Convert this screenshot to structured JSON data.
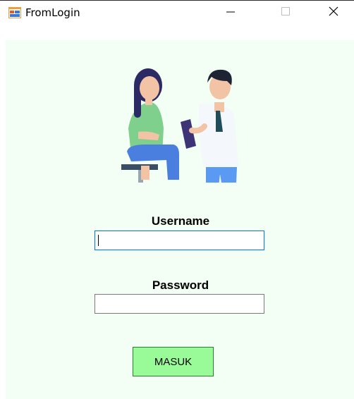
{
  "window": {
    "title": "FromLogin",
    "icons": [
      "app-form-icon",
      "minimize-icon",
      "maximize-icon",
      "close-icon"
    ]
  },
  "form": {
    "illustration": "patient-and-doctor-illustration",
    "username_label": "Username",
    "username_value": "",
    "password_label": "Password",
    "password_value": "",
    "submit_label": "MASUK"
  },
  "colors": {
    "client_background": "#f3fff4",
    "button_background": "#98fb98",
    "focus_border": "#0078d7"
  }
}
